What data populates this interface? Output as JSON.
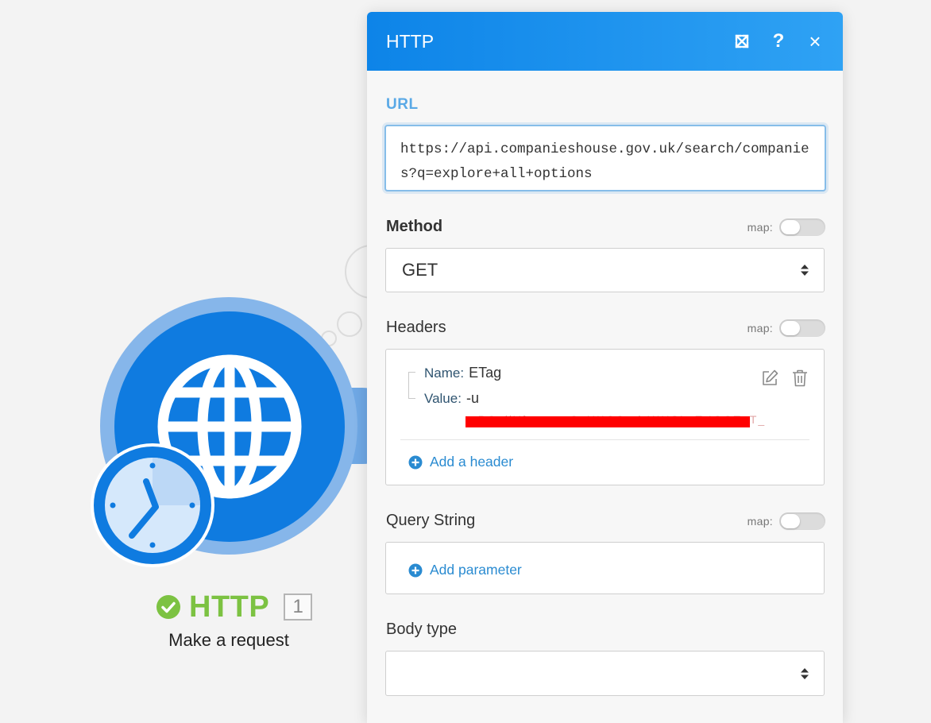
{
  "module": {
    "name": "HTTP",
    "number": "1",
    "subtitle": "Make a request",
    "icons": [
      "globe-icon",
      "clock-icon",
      "check-circle-icon"
    ]
  },
  "panel": {
    "title": "HTTP",
    "header_buttons": [
      "expand-icon",
      "help-icon",
      "close-icon"
    ],
    "help_glyph": "?",
    "close_glyph": "×"
  },
  "map_label": "map:",
  "url": {
    "label": "URL",
    "value": "https://api.companieshouse.gov.uk/search/companies?q=explore+all+options"
  },
  "method": {
    "label": "Method",
    "value": "GET"
  },
  "headers": {
    "label": "Headers",
    "items": [
      {
        "name_label": "Name:",
        "name": "ETag",
        "value_label": "Value:",
        "value": "-u",
        "value_line2": "_PO_ilYfor_ :_ C_UIICO_ l:HIUSL_T-IOOT_T_"
      }
    ],
    "add_label": "Add a header"
  },
  "query_string": {
    "label": "Query String",
    "add_label": "Add parameter"
  },
  "body_type": {
    "label": "Body type",
    "value": ""
  },
  "colors": {
    "accent": "#0f7be0",
    "header_start": "#0d84e8",
    "header_end": "#2fa2f4",
    "link": "#2a8bd1",
    "success": "#7cc242",
    "redaction": "#ff0000"
  }
}
